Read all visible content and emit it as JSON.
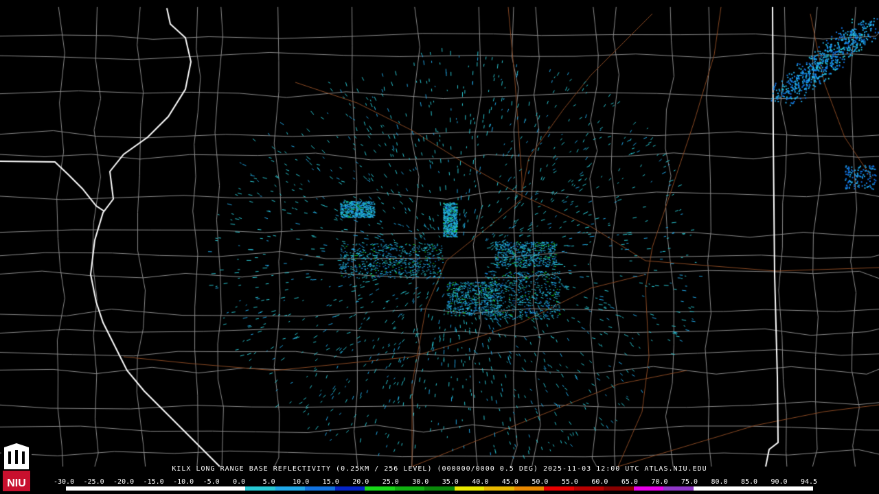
{
  "product": {
    "title_line": "KILX LONG RANGE BASE REFLECTIVITY (0.25KM / 256 LEVEL) (000000/0000 0.5 DEG) 2025-11-03 12:00 UTC  ATLAS.NIU.EDU"
  },
  "legend": {
    "labels": [
      "-30.0",
      "-25.0",
      "-20.0",
      "-15.0",
      "-10.0",
      "-5.0",
      "0.0",
      "5.0",
      "10.0",
      "15.0",
      "20.0",
      "25.0",
      "30.0",
      "35.0",
      "40.0",
      "45.0",
      "50.0",
      "55.0",
      "60.0",
      "65.0",
      "70.0",
      "75.0",
      "80.0",
      "85.0",
      "90.0",
      "94.5"
    ],
    "colors": [
      "#ffffff",
      "#ffffff",
      "#ffffff",
      "#ffffff",
      "#ffffff",
      "#ffffff",
      "#29c9d4",
      "#20a8e8",
      "#1272e0",
      "#0424c8",
      "#18d818",
      "#10b010",
      "#0a880a",
      "#e8e800",
      "#e8b800",
      "#e88800",
      "#e80000",
      "#b80000",
      "#880000",
      "#e800e8",
      "#9038c8",
      "#ffffff",
      "#ffffff",
      "#ffffff",
      "#ffffff"
    ]
  },
  "logo": {
    "text": "NIU",
    "color": "#c8102e"
  },
  "map_style": {
    "county_line_color": "#8c8c8c",
    "state_line_color": "#ffffff",
    "highway_color": "#8b4a24",
    "background": "#000000"
  },
  "radar": {
    "site": "KILX",
    "echo_colors": [
      "#29c9d4",
      "#20a8e8",
      "#1272e0",
      "#18d818"
    ]
  }
}
